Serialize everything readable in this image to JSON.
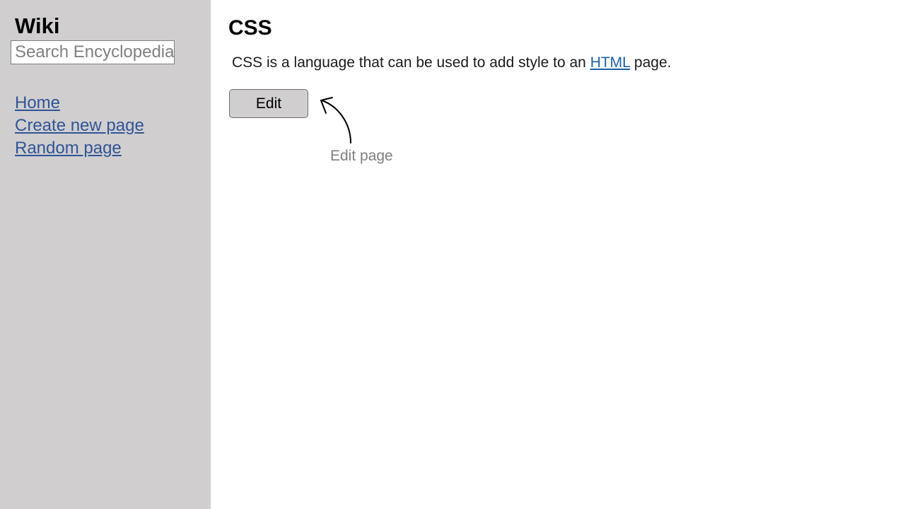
{
  "sidebar": {
    "title": "Wiki",
    "search": {
      "placeholder": "Search Encyclopedia",
      "value": ""
    },
    "links": [
      {
        "label": "Home"
      },
      {
        "label": "Create new page"
      },
      {
        "label": "Random page"
      }
    ]
  },
  "main": {
    "title": "CSS",
    "body": {
      "text_before": "CSS is a language that can be used to add style to an ",
      "link_label": "HTML",
      "text_after": " page."
    },
    "edit_button_label": "Edit",
    "annotation": {
      "label": "Edit page",
      "icon": "curved-arrow-icon"
    }
  },
  "colors": {
    "sidebar_background": "#d0cecf",
    "link": "#2f5597",
    "button_background": "#d0cecf",
    "annotation_text": "#7f7f7f"
  }
}
